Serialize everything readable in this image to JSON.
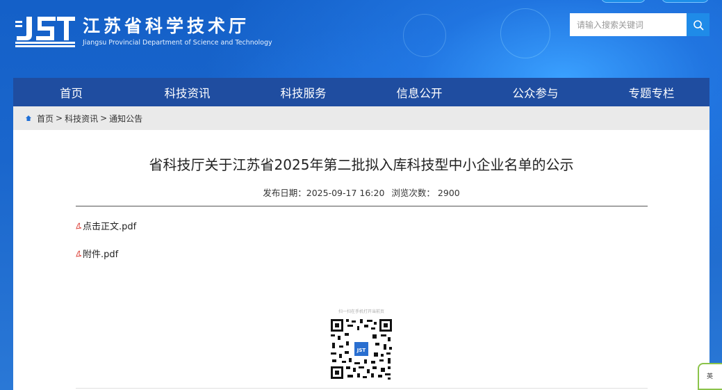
{
  "header": {
    "site_title": "江苏省科学技术厅",
    "site_subtitle": "Jiangsu Provincial Department of Science and Technology",
    "logo_letters": "JST",
    "search_placeholder": "请输入搜索关键词"
  },
  "nav": {
    "items": [
      "首页",
      "科技资讯",
      "科技服务",
      "信息公开",
      "公众参与",
      "专题专栏"
    ]
  },
  "breadcrumb": {
    "home": "首页",
    "separator": ">",
    "level1": "科技资讯",
    "level2": "通知公告"
  },
  "article": {
    "title": "省科技厅关于江苏省2025年第二批拟入库科技型中小企业名单的公示",
    "publish_label": "发布日期：",
    "publish_date": "2025-09-17 16:20",
    "views_label": "浏览次数：",
    "views": "2900",
    "attachments": [
      "点击正文.pdf",
      "附件.pdf"
    ],
    "qr_caption": "扫一扫在手机打开当前页"
  },
  "corner_widget": {
    "label": "英"
  },
  "colors": {
    "nav_bg": "#1f4da0",
    "header_bg": "#1460c8",
    "search_button": "#1f8be8",
    "pdf_icon": "#d9342b"
  }
}
